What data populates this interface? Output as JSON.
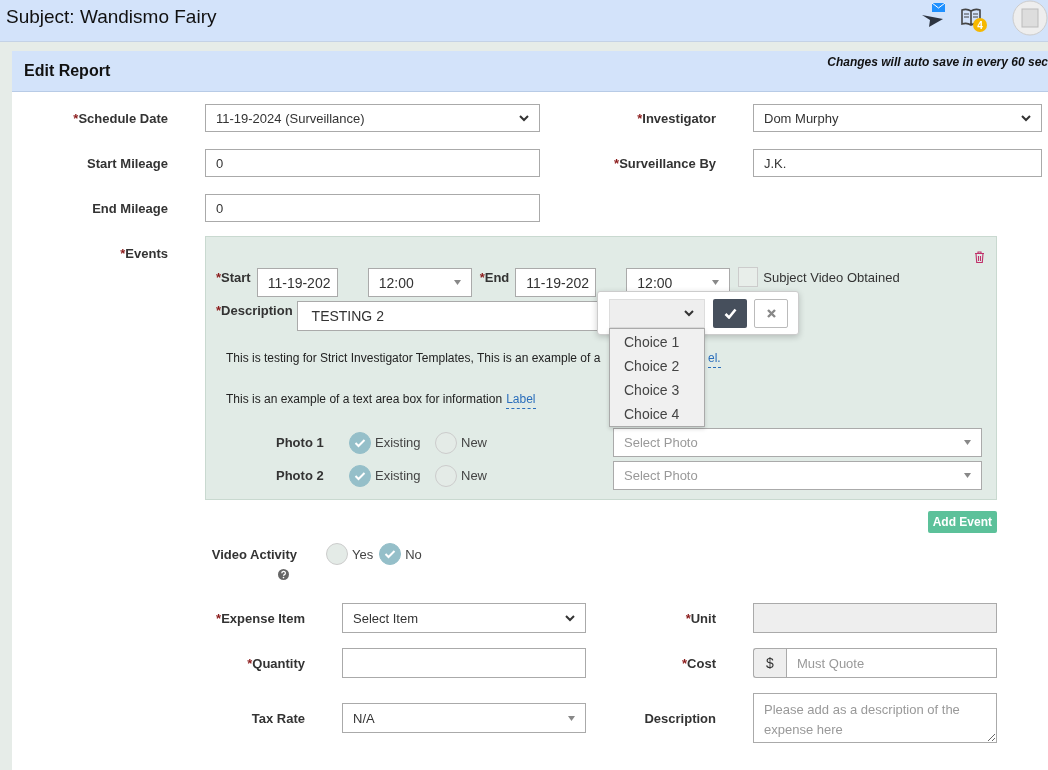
{
  "header": {
    "subject": "Subject: Wandismo Fairy",
    "notification_badge": "4"
  },
  "card": {
    "title": "Edit Report",
    "autosave_note": "Changes will auto save in every 60 sec"
  },
  "top_rows": [
    [
      {
        "required_mark": "*",
        "label": "Schedule Date",
        "kind": "select",
        "value": "11-19-2024 (Surveillance)"
      },
      {
        "required_mark": "*",
        "label": "Investigator",
        "kind": "select",
        "value": "Dom Murphy"
      }
    ],
    [
      {
        "label": "Start Mileage",
        "kind": "input",
        "value": "0"
      },
      {
        "required_mark": "*",
        "label": "Surveillance By",
        "kind": "input",
        "value": "J.K."
      }
    ],
    [
      {
        "label": "End Mileage",
        "kind": "input",
        "value": "0"
      }
    ]
  ],
  "events": {
    "required_mark": "*",
    "label": "Events",
    "start": {
      "required_mark": "*",
      "label": "Start",
      "date": "11-19-202",
      "time": "12:00"
    },
    "end": {
      "required_mark": "*",
      "label": "End",
      "date": "11-19-202",
      "time": "12:00"
    },
    "video_obtained": {
      "label": "Subject Video Obtained",
      "checked": false
    },
    "description": {
      "required_mark": "*",
      "label": "Description",
      "value": "TESTING 2"
    },
    "info_lines": [
      {
        "text": "This is testing for Strict Investigator Templates, This is an example of a",
        "link": "el."
      },
      {
        "text": "This is an example of a text area box for information",
        "link": "Label"
      }
    ],
    "photos": [
      {
        "label": "Photo 1",
        "options": [
          {
            "label": "Existing",
            "selected": true
          },
          {
            "label": "New",
            "selected": false
          }
        ],
        "placeholder": "Select Photo"
      },
      {
        "label": "Photo 2",
        "options": [
          {
            "label": "Existing",
            "selected": true
          },
          {
            "label": "New",
            "selected": false
          }
        ],
        "placeholder": "Select Photo"
      }
    ],
    "popup": {
      "choices": [
        "Choice 1",
        "Choice 2",
        "Choice 3",
        "Choice 4"
      ]
    },
    "add_button": "Add Event"
  },
  "video_activity": {
    "label": "Video Activity",
    "options": [
      {
        "label": "Yes",
        "selected": false
      },
      {
        "label": "No",
        "selected": true
      }
    ]
  },
  "expense_rows": [
    [
      {
        "required_mark": "*",
        "label": "Expense Item",
        "kind": "select",
        "value": "Select Item"
      },
      {
        "required_mark": "*",
        "label": "Unit",
        "kind": "readonly"
      }
    ],
    [
      {
        "required_mark": "*",
        "label": "Quantity",
        "kind": "input"
      },
      {
        "required_mark": "*",
        "label": "Cost",
        "kind": "currency",
        "prefix": "$",
        "placeholder": "Must Quote"
      }
    ],
    [
      {
        "label": "Tax Rate",
        "kind": "combo",
        "value": "N/A"
      },
      {
        "label": "Description",
        "kind": "textarea",
        "placeholder": "Please add as a description of the expense here"
      }
    ]
  ]
}
